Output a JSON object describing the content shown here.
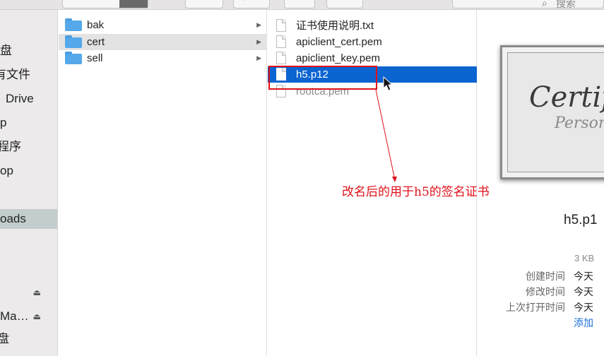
{
  "window": {
    "search_placeholder": "搜索"
  },
  "sidebar": {
    "items": [
      {
        "label": "盘"
      },
      {
        "label": "有文件"
      },
      {
        "label": "Drive"
      },
      {
        "label": "p"
      },
      {
        "label": "程序"
      },
      {
        "label": "op"
      },
      {
        "label": "oads"
      },
      {
        "label": "Ma…"
      },
      {
        "label": "盘"
      }
    ]
  },
  "column1": {
    "items": [
      {
        "label": "bak"
      },
      {
        "label": "cert"
      },
      {
        "label": "sell"
      }
    ]
  },
  "column2": {
    "items": [
      {
        "label": "证书使用说明.txt"
      },
      {
        "label": "apiclient_cert.pem"
      },
      {
        "label": "apiclient_key.pem"
      },
      {
        "label": "h5.p12"
      },
      {
        "label": "rootca.pem"
      }
    ]
  },
  "preview": {
    "cert_script": "Certif",
    "cert_sub": "Persona",
    "file_name": "h5.p1",
    "size": "3 KB",
    "created_label": "创建时间",
    "created_value": "今天",
    "modified_label": "修改时间",
    "modified_value": "今天",
    "opened_label": "上次打开时间",
    "opened_value": "今天",
    "add_tags": "添加"
  },
  "annotation": {
    "text": "改名后的用于h5的签名证书",
    "color": "#e0101a"
  },
  "colors": {
    "selection": "#0b64d0",
    "folder": "#55a9ea",
    "sidebar_selected": "#c3cdcd"
  }
}
